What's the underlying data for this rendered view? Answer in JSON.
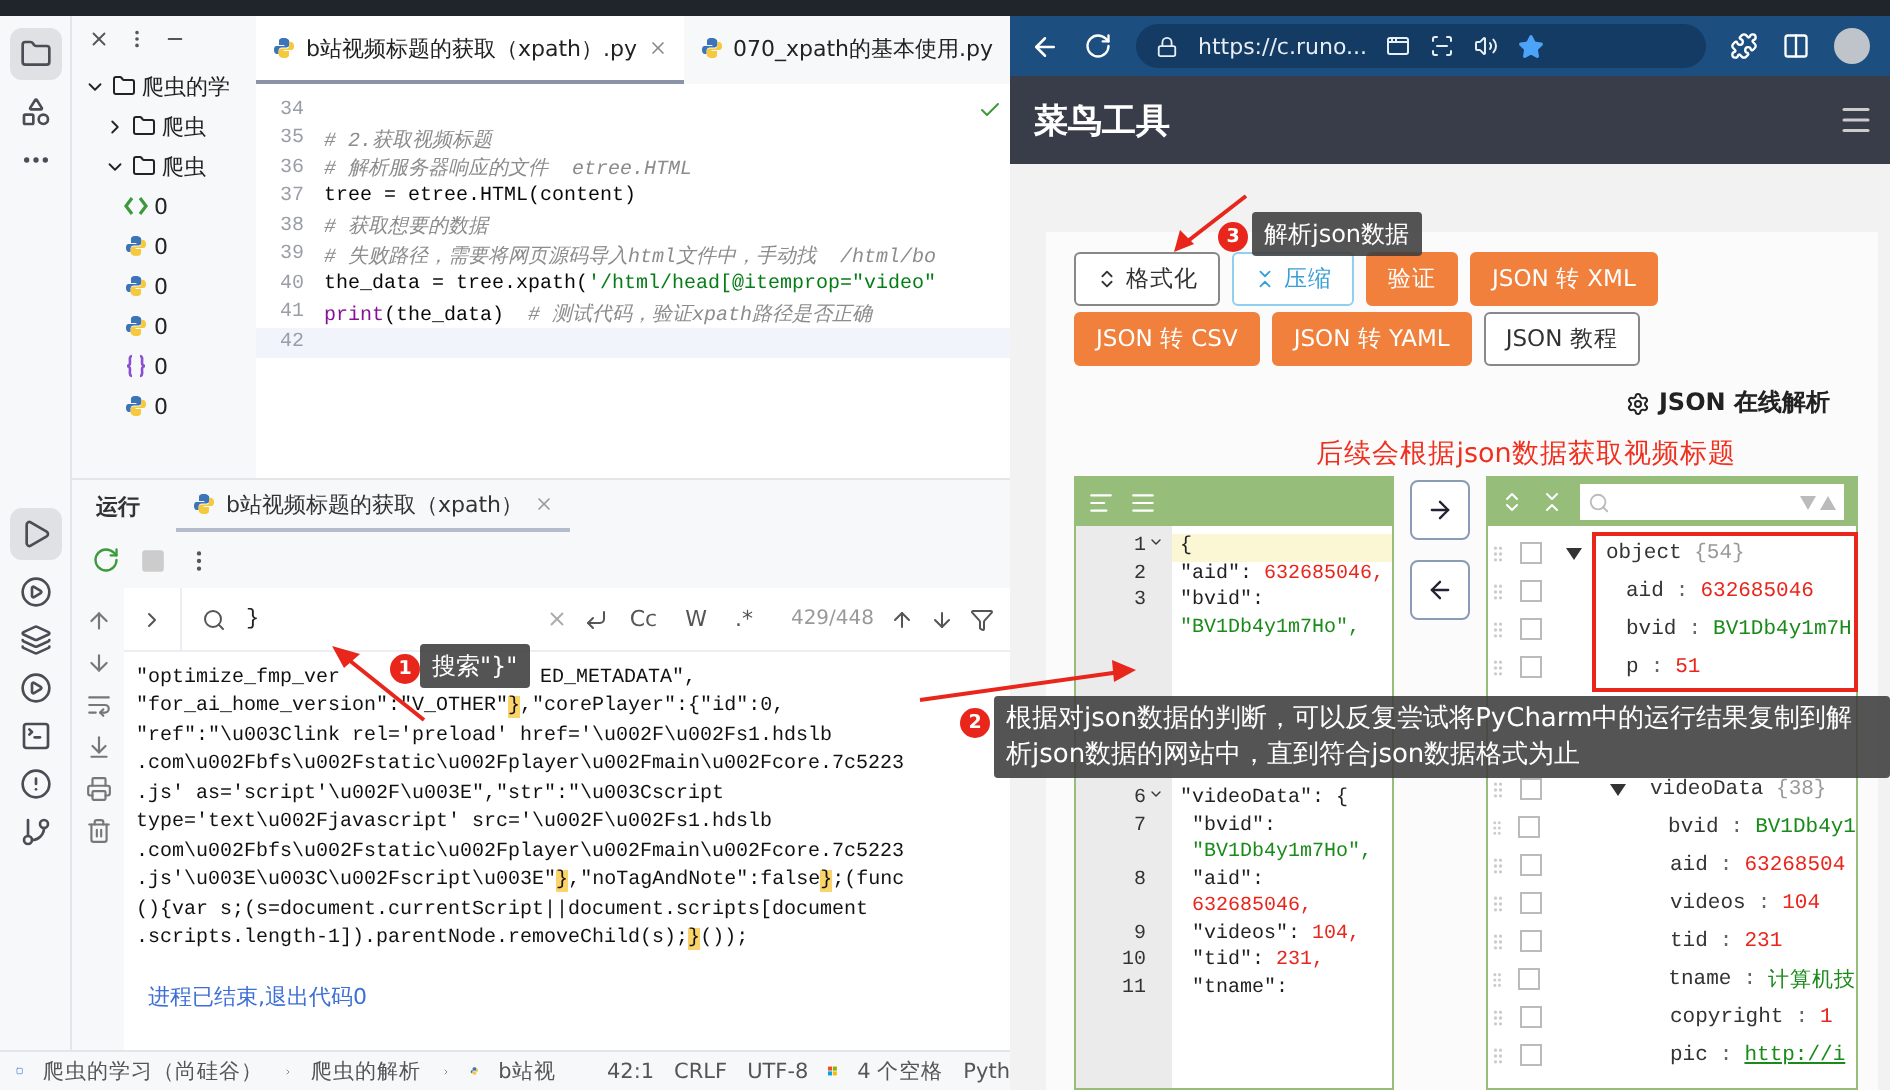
{
  "ide": {
    "project": {
      "items": [
        {
          "label": "爬虫的学",
          "expanded": true,
          "children": [
            {
              "label": "爬虫",
              "expanded": false
            },
            {
              "label": "爬虫",
              "expanded": true,
              "children": [
                {
                  "label": "0",
                  "kind": "html"
                },
                {
                  "label": "0",
                  "kind": "python"
                },
                {
                  "label": "0",
                  "kind": "python"
                },
                {
                  "label": "0",
                  "kind": "python"
                },
                {
                  "label": "0",
                  "kind": "json"
                },
                {
                  "label": "0",
                  "kind": "python"
                }
              ]
            }
          ]
        }
      ]
    },
    "editor_tabs": [
      {
        "label": "b站视频标题的获取（xpath）.py",
        "selected": true
      },
      {
        "label": "070_xpath的基本使用.py",
        "selected": false
      }
    ],
    "code_lines": [
      {
        "number": "34",
        "current": false
      },
      {
        "number": "35",
        "current": false,
        "segments": [
          {
            "kind": "comment",
            "text": "# 2.获取视频标题"
          }
        ]
      },
      {
        "number": "36",
        "current": false,
        "segments": [
          {
            "kind": "comment",
            "text": "# 解析服务器响应的文件  etree.HTML"
          }
        ]
      },
      {
        "number": "37",
        "current": false,
        "segments": [
          {
            "kind": "plain",
            "text": "tree = etree.HTML(content)"
          }
        ]
      },
      {
        "number": "38",
        "current": false,
        "segments": [
          {
            "kind": "comment",
            "text": "# 获取想要的数据"
          }
        ]
      },
      {
        "number": "39",
        "current": false,
        "segments": [
          {
            "kind": "comment",
            "text": "# 失败路径，需要将网页源码导入html文件中，手动找  /html/bo"
          }
        ]
      },
      {
        "number": "40",
        "current": false,
        "segments": [
          {
            "kind": "plain",
            "text": "the_data = tree.xpath("
          },
          {
            "kind": "string",
            "text": "'/html/head[@itemprop=\"video\""
          }
        ]
      },
      {
        "number": "41",
        "current": false,
        "segments": [
          {
            "kind": "keyword",
            "text": "print"
          },
          {
            "kind": "plain",
            "text": "(the_data)  "
          },
          {
            "kind": "comment",
            "text": "# 测试代码，验证xpath路径是否正确"
          }
        ]
      },
      {
        "number": "42",
        "current": true
      }
    ],
    "run_panel": {
      "title": "运行",
      "tab": "b站视频标题的获取（xpath）",
      "search": {
        "value": "}",
        "options": [
          {
            "label": "Cc",
            "selected": false
          },
          {
            "label": "W",
            "selected": false
          },
          {
            "label": ".*",
            "selected": false
          }
        ],
        "count": "429/448"
      },
      "output_lines": [
        [
          {
            "kind": "text",
            "text": "\"optimize_fmp_ver"
          },
          {
            "kind": "covered"
          },
          {
            "kind": "text",
            "text": "ED_METADATA\","
          }
        ],
        [
          {
            "kind": "text",
            "text": "\"for_ai_home_version\":\"V_OTHER\""
          },
          {
            "kind": "match",
            "text": "}"
          },
          {
            "kind": "text",
            "text": ",\"corePlayer\":{\"id\":0,"
          }
        ],
        [
          {
            "kind": "text",
            "text": "\"ref\":\"\\u003Clink rel='preload' href='\\u002F\\u002Fs1.hdslb"
          }
        ],
        [
          {
            "kind": "text",
            "text": ".com\\u002Fbfs\\u002Fstatic\\u002Fplayer\\u002Fmain\\u002Fcore.7c5223"
          }
        ],
        [
          {
            "kind": "text",
            "text": ".js' as='script'\\u002F\\u003E\",\"str\":\"\\u003Cscript"
          }
        ],
        [
          {
            "kind": "text",
            "text": "type='text\\u002Fjavascript' src='\\u002F\\u002Fs1.hdslb"
          }
        ],
        [
          {
            "kind": "text",
            "text": ".com\\u002Fbfs\\u002Fstatic\\u002Fplayer\\u002Fmain\\u002Fcore.7c5223"
          }
        ],
        [
          {
            "kind": "text",
            "text": ".js'\\u003E\\u003C\\u002Fscript\\u003E\""
          },
          {
            "kind": "match",
            "text": "}"
          },
          {
            "kind": "text",
            "text": ",\"noTagAndNote\":false"
          },
          {
            "kind": "match",
            "text": "}"
          },
          {
            "kind": "text",
            "text": ";(func"
          }
        ],
        [
          {
            "kind": "text",
            "text": "(){var s;(s=document.currentScript||document.scripts[document"
          }
        ],
        [
          {
            "kind": "text",
            "text": ".scripts.length-1]).parentNode.removeChild(s);"
          },
          {
            "kind": "match",
            "text": "}"
          },
          {
            "kind": "text",
            "text": "());"
          }
        ]
      ],
      "exit_message": "进程已结束,退出代码0"
    },
    "status_bar": {
      "breadcrumbs": [
        "爬虫的学习（尚硅谷）",
        "爬虫的解析",
        "b站视"
      ],
      "items": [
        "42:1",
        "CRLF",
        "UTF-8",
        "4 个空格",
        "Pyth"
      ]
    }
  },
  "browser": {
    "url": "https://c.runo...",
    "site_title": "菜鸟工具",
    "buttons": [
      {
        "label": "格式化",
        "kind": "format"
      },
      {
        "label": "压缩",
        "kind": "compress"
      },
      {
        "label": "验证",
        "kind": "orange"
      },
      {
        "label": "JSON 转 XML",
        "kind": "orange"
      },
      {
        "label": "JSON 转 CSV",
        "kind": "orange"
      },
      {
        "label": "JSON 转 YAML",
        "kind": "orange"
      },
      {
        "label": "JSON 教程",
        "kind": "outline"
      }
    ],
    "heading": "JSON 在线解析",
    "note": "后续会根据json数据获取视频标题",
    "editor_lines": [
      {
        "kind": "line",
        "number": "1",
        "fold": true,
        "current": true,
        "open": "{"
      },
      {
        "kind": "line",
        "number": "2",
        "fold": false,
        "current": false,
        "key": "\"aid\":",
        "value": "632685046,",
        "color": "#e8261c"
      },
      {
        "kind": "line",
        "number": "3",
        "fold": false,
        "current": false,
        "key": "\"bvid\":",
        "value": "\"BV1Db4y1m7Ho\",",
        "color": "#1a8a1a"
      },
      {
        "kind": "covered"
      },
      {
        "kind": "line",
        "number": "6",
        "fold": true,
        "current": false,
        "key": "\"videoData\":",
        "open": "{",
        "children": [
          {
            "kind": "line",
            "number": "7",
            "fold": false,
            "current": false,
            "key": "\"bvid\":",
            "value": "\"BV1Db4y1m7Ho\",",
            "color": "#1a8a1a"
          },
          {
            "kind": "line",
            "number": "8",
            "fold": false,
            "current": false,
            "key": "\"aid\":",
            "value": "632685046,",
            "color": "#e8261c"
          },
          {
            "kind": "line",
            "number": "9",
            "fold": false,
            "current": false,
            "key": "\"videos\":",
            "value": "104,",
            "color": "#e8261c"
          },
          {
            "kind": "line",
            "number": "10",
            "fold": false,
            "current": false,
            "key": "\"tid\":",
            "value": "231,",
            "color": "#e8261c"
          },
          {
            "kind": "line",
            "number": "11",
            "fold": false,
            "current": false,
            "key": "\"tname\":"
          }
        ]
      }
    ],
    "tree": [
      {
        "kind": "node",
        "key": "object",
        "count": "{54}",
        "expanded": true,
        "checked": false,
        "children": [
          {
            "kind": "value",
            "key": "aid",
            "separator": ":",
            "value": "632685046",
            "color": "#e8261c",
            "checked": false
          },
          {
            "kind": "value",
            "key": "bvid",
            "separator": ":",
            "value": "BV1Db4y1m7H",
            "color": "#1a8a1a",
            "checked": false
          },
          {
            "kind": "value",
            "key": "p",
            "separator": ":",
            "value": "51",
            "color": "#e8261c",
            "checked": false
          },
          {
            "kind": "covered"
          },
          {
            "kind": "node",
            "key": "videoData",
            "count": "{38}",
            "expanded": true,
            "checked": false,
            "children": [
              {
                "kind": "value",
                "key": "bvid",
                "separator": ":",
                "value": "BV1Db4y1",
                "color": "#1a8a1a",
                "checked": false
              },
              {
                "kind": "value",
                "key": "aid",
                "separator": ":",
                "value": "63268504",
                "color": "#e8261c",
                "checked": false
              },
              {
                "kind": "value",
                "key": "videos",
                "separator": ":",
                "value": "104",
                "color": "#e8261c",
                "checked": false
              },
              {
                "kind": "value",
                "key": "tid",
                "separator": ":",
                "value": "231",
                "color": "#e8261c",
                "checked": false
              },
              {
                "kind": "value",
                "key": "tname",
                "separator": ":",
                "value": "计算机技",
                "color": "#1a8a1a",
                "checked": false
              },
              {
                "kind": "value",
                "key": "copyright",
                "separator": ":",
                "value": "1",
                "color": "#e8261c",
                "checked": false
              },
              {
                "kind": "value",
                "key": "pic",
                "separator": ":",
                "value": "http://i",
                "color": "#1a8a1a",
                "checked": false
              }
            ]
          }
        ]
      }
    ]
  },
  "annotations": [
    {
      "number": "1",
      "text": "搜索\"}\""
    },
    {
      "number": "2",
      "text": "根据对json数据的判断，可以反复尝试将PyCharm中的运行结果复制到解析json数据的网站中，直到符合json数据格式为止"
    },
    {
      "number": "3",
      "text": "解析json数据"
    }
  ]
}
